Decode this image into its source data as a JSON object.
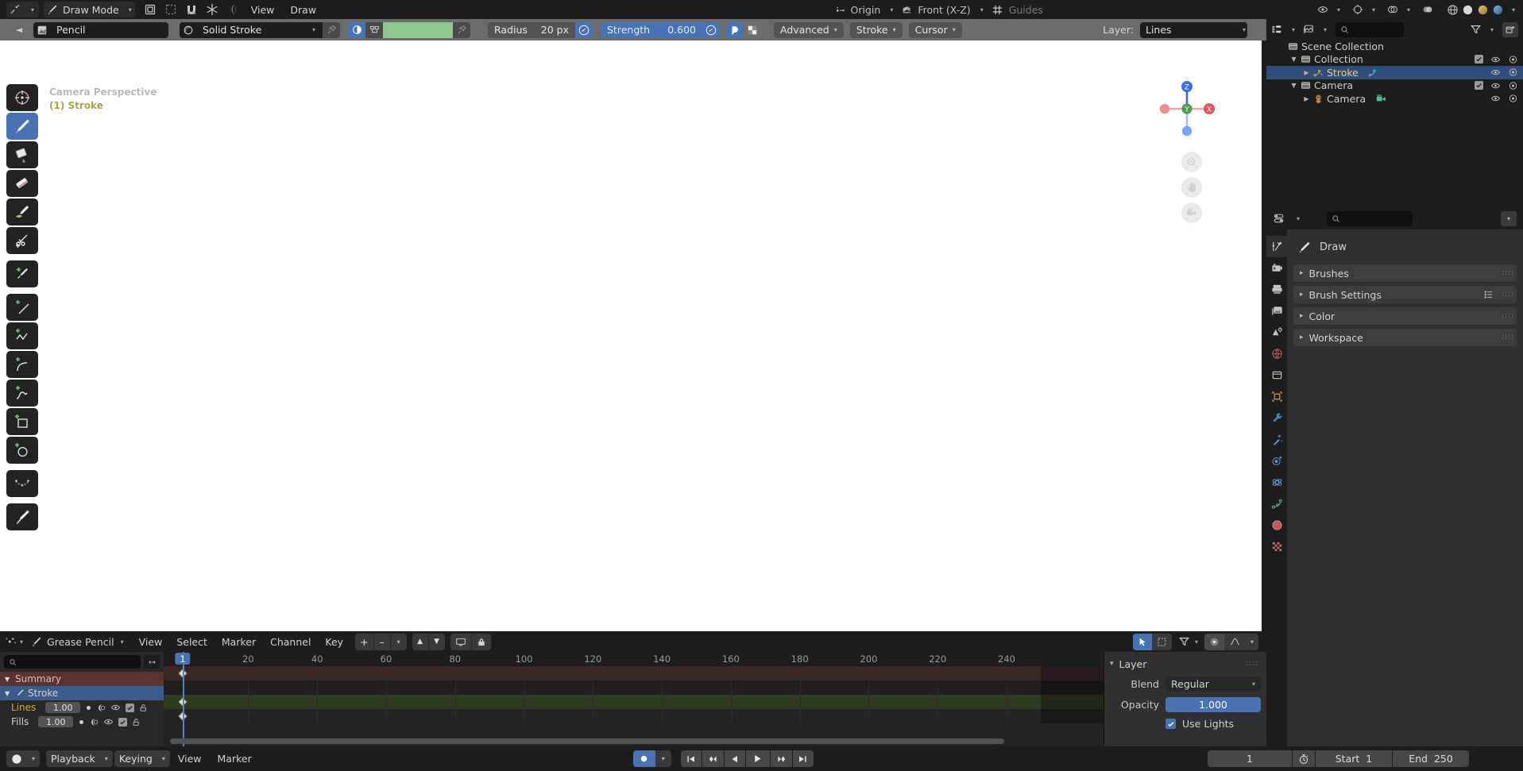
{
  "topbar": {
    "editor_type": "editor-type-selector",
    "mode": "Draw Mode",
    "menus": [
      "View",
      "Draw"
    ],
    "origin_label": "Origin",
    "orientation_label": "Front (X-Z)",
    "guides_label": "Guides"
  },
  "toolheader": {
    "brush_name": "Pencil",
    "material_name": "Solid Stroke",
    "radius_label": "Radius",
    "radius_value": "20 px",
    "strength_label": "Strength",
    "strength_value": "0.600",
    "advanced_label": "Advanced",
    "stroke_label": "Stroke",
    "cursor_label": "Cursor",
    "layer_label": "Layer:",
    "layer_value": "Lines",
    "material_color": "#8fc98f",
    "accent": "#4772b3"
  },
  "viewport": {
    "perspective_text": "Camera Perspective",
    "object_text": "(1) Stroke",
    "tools": [
      {
        "name": "tweak-tool",
        "active": false
      },
      {
        "name": "draw-tool",
        "active": true
      },
      {
        "name": "fill-tool",
        "active": false
      },
      {
        "name": "erase-tool",
        "active": false
      },
      {
        "name": "tint-tool",
        "active": false
      },
      {
        "name": "cutter-tool",
        "active": false
      },
      {
        "name": "eyedropper-tool",
        "active": false
      },
      {
        "name": "line-tool",
        "active": false
      },
      {
        "name": "polyline-tool",
        "active": false
      },
      {
        "name": "arc-tool",
        "active": false
      },
      {
        "name": "curve-tool",
        "active": false
      },
      {
        "name": "box-tool",
        "active": false
      },
      {
        "name": "circle-tool",
        "active": false
      },
      {
        "name": "interpolate-tool",
        "active": false
      },
      {
        "name": "annotate-tool",
        "active": false
      }
    ],
    "gizmo_axes": [
      "Z",
      "Y",
      "X"
    ]
  },
  "outliner": {
    "search_placeholder": "",
    "rows": [
      {
        "name": "Scene Collection",
        "indent": 0,
        "type": "collection",
        "expander": "",
        "selected": false,
        "checkbox": false,
        "eye": false,
        "camera": false
      },
      {
        "name": "Collection",
        "indent": 1,
        "type": "collection",
        "expander": "down",
        "selected": false,
        "checkbox": true,
        "eye": true,
        "camera": true
      },
      {
        "name": "Stroke",
        "indent": 2,
        "type": "grease-pencil",
        "expander": "right",
        "selected": true,
        "checkbox": false,
        "eye": true,
        "camera": true
      },
      {
        "name": "Camera",
        "indent": 1,
        "type": "collection",
        "expander": "down",
        "selected": false,
        "checkbox": true,
        "eye": true,
        "camera": true
      },
      {
        "name": "Camera",
        "indent": 2,
        "type": "camera-object",
        "expander": "right",
        "selected": false,
        "checkbox": false,
        "eye": true,
        "camera": true
      }
    ]
  },
  "properties": {
    "search_placeholder": "",
    "context_title": "Draw",
    "panels": [
      {
        "label": "Brushes",
        "expanded": false,
        "has_list_icon": false
      },
      {
        "label": "Brush Settings",
        "expanded": false,
        "has_list_icon": true
      },
      {
        "label": "Color",
        "expanded": false,
        "has_list_icon": false
      },
      {
        "label": "Workspace",
        "expanded": false,
        "has_list_icon": false
      }
    ],
    "tabs": [
      {
        "name": "tool-tab",
        "active": true
      },
      {
        "name": "render-tab",
        "active": false
      },
      {
        "name": "output-tab",
        "active": false
      },
      {
        "name": "view-layer-tab",
        "active": false
      },
      {
        "name": "scene-tab",
        "active": false
      },
      {
        "name": "world-tab",
        "active": false
      },
      {
        "name": "collection-tab",
        "active": false
      },
      {
        "name": "object-tab",
        "active": false
      },
      {
        "name": "modifier-tab",
        "active": false
      },
      {
        "name": "effects-tab",
        "active": false
      },
      {
        "name": "particles-tab",
        "active": false
      },
      {
        "name": "physics-tab",
        "active": false
      },
      {
        "name": "object-data-tab",
        "active": false
      },
      {
        "name": "material-tab",
        "active": false
      },
      {
        "name": "texture-tab",
        "active": false
      }
    ]
  },
  "dopesheet": {
    "mode": "Grease Pencil",
    "menus": [
      "View",
      "Select",
      "Marker",
      "Channel",
      "Key"
    ],
    "search_placeholder": "",
    "channels": [
      {
        "label": "Summary",
        "type": "summary",
        "expander": "down",
        "value": null,
        "keys": [
          1
        ]
      },
      {
        "label": "Stroke",
        "type": "object",
        "expander": "down",
        "value": null,
        "keys": []
      },
      {
        "label": "Lines",
        "type": "layer",
        "expander": "",
        "value": "1.00",
        "keys": [
          1
        ],
        "highlight": true
      },
      {
        "label": "Fills",
        "type": "layer",
        "expander": "",
        "value": "1.00",
        "keys": [
          1
        ],
        "highlight": false
      }
    ],
    "ruler_ticks": [
      1,
      20,
      40,
      60,
      80,
      100,
      120,
      140,
      160,
      180,
      200,
      220,
      240
    ],
    "current_frame": 1,
    "frame_badge": "1",
    "range_end_marker": 250
  },
  "layer_panel": {
    "title": "Layer",
    "blend_label": "Blend",
    "blend_value": "Regular",
    "opacity_label": "Opacity",
    "opacity_value": "1.000",
    "use_lights_label": "Use Lights",
    "use_lights_checked": true
  },
  "bottombar": {
    "menus": [
      "Playback",
      "Keying",
      "View",
      "Marker"
    ],
    "playback_label": "Playback",
    "keying_label": "Keying",
    "current_frame": "1",
    "start_label": "Start",
    "start_value": "1",
    "end_label": "End",
    "end_value": "250"
  }
}
